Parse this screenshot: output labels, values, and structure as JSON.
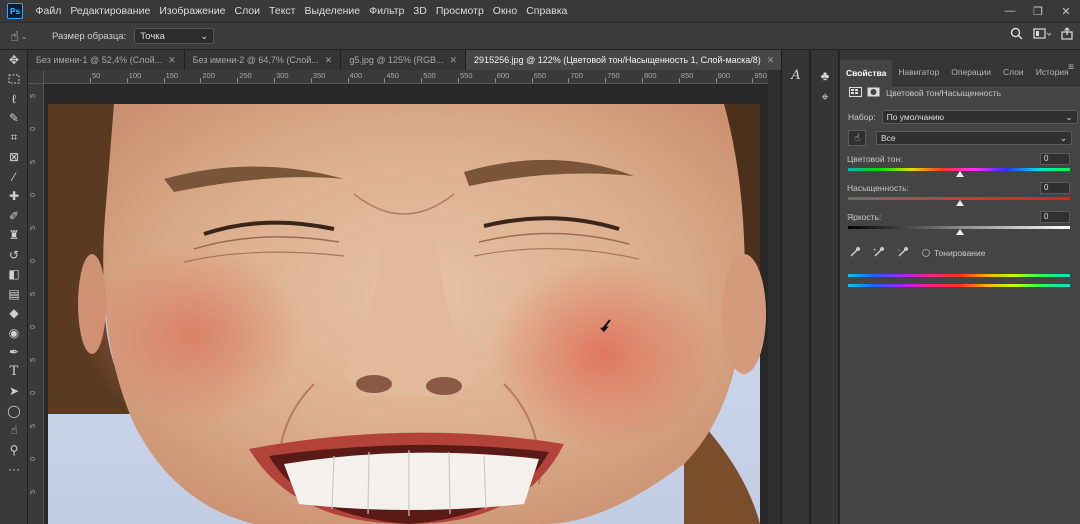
{
  "app": {
    "logo": "Ps",
    "menu": [
      "Файл",
      "Редактирование",
      "Изображение",
      "Слои",
      "Текст",
      "Выделение",
      "Фильтр",
      "3D",
      "Просмотр",
      "Окно",
      "Справка"
    ],
    "window_controls": [
      "—",
      "❐",
      "✕"
    ]
  },
  "options": {
    "tool_icon": "hand-icon",
    "sample_size_label": "Размер образца:",
    "sample_size_value": "Точка"
  },
  "tabs": [
    {
      "label": "Без имени-1 @ 52,4% (Слой...",
      "active": false
    },
    {
      "label": "Без имени-2 @ 64,7% (Слой...",
      "active": false
    },
    {
      "label": "g5.jpg @ 125% (RGB...",
      "active": false
    },
    {
      "label": "2915256.jpg @ 122% (Цветовой тон/Насыщенность 1, Слой-маска/8)",
      "active": true
    }
  ],
  "ruler": {
    "top": [
      "50",
      "100",
      "150",
      "200",
      "250",
      "300",
      "350",
      "400",
      "450",
      "500",
      "550",
      "600",
      "650",
      "700",
      "750",
      "800",
      "850",
      "900",
      "950"
    ],
    "left": [
      "5",
      "0",
      "5",
      "0",
      "5",
      "0",
      "5",
      "0",
      "5",
      "0",
      "5",
      "0",
      "5"
    ]
  },
  "panel": {
    "tabs": [
      "Свойства",
      "Навигатор",
      "Операции",
      "Слои",
      "История"
    ],
    "title": "Цветовой тон/Насыщенность",
    "preset_label": "Набор:",
    "preset_value": "По умолчанию",
    "channel_value": "Все",
    "hue_label": "Цветовой тон:",
    "hue_value": "0",
    "saturation_label": "Насыщенность:",
    "saturation_value": "0",
    "lightness_label": "Яркость:",
    "lightness_value": "0",
    "colorize_label": "Тонирование"
  },
  "colors": {
    "accent": "#31a8ff",
    "panel_bg": "#444444",
    "menubar_bg": "#393939"
  }
}
